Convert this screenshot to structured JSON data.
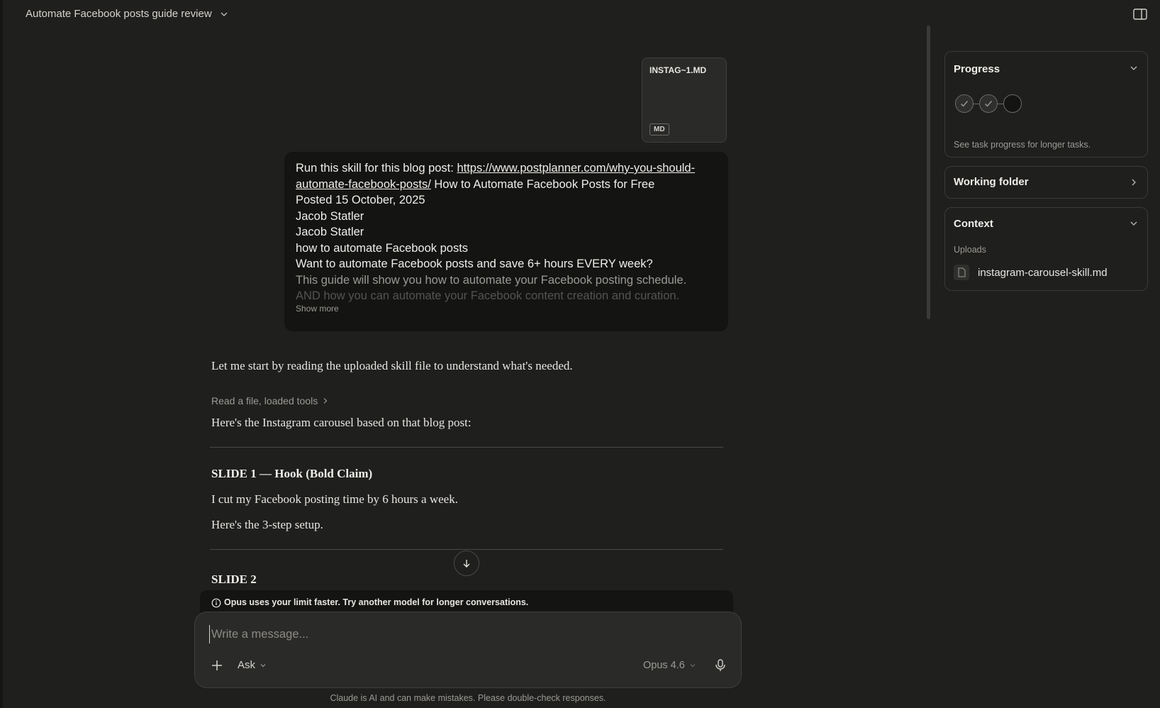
{
  "header": {
    "chat_title": "Automate Facebook posts guide review"
  },
  "attachment": {
    "file_name": "INSTAG~1.MD",
    "file_type": "MD"
  },
  "user_message": {
    "line1_prefix": "Run this skill for this blog post: ",
    "link_text_a": "https://www.postplanner.com/why-you-should-",
    "link_text_b": "automate-facebook-posts/",
    "line2_suffix": " How to Automate Facebook Posts for Free",
    "line3": "Posted 15 October, 2025",
    "line4": "Jacob Statler",
    "line5": "Jacob Statler",
    "line6": "how to automate Facebook posts",
    "line7": "Want to automate Facebook posts and save 6+ hours EVERY week?",
    "line8": "This guide will show you how to automate your Facebook posting schedule.",
    "line9": "AND how you can automate your Facebook content creation and curation.",
    "show_more": "Show more"
  },
  "assistant": {
    "intro": "Let me start by reading the uploaded skill file to understand what's needed.",
    "tool_summary": "Read a file, loaded tools",
    "lead": "Here's the Instagram carousel based on that blog post:",
    "slide1_heading": "SLIDE 1 — Hook (Bold Claim)",
    "slide1_line1": "I cut my Facebook posting time by 6 hours a week.",
    "slide1_line2": "Here's the 3-step setup.",
    "slide2_heading": "SLIDE 2"
  },
  "composer": {
    "warning": "Opus uses your limit faster. Try another model for longer conversations.",
    "placeholder": "Write a message...",
    "mode_label": "Ask",
    "model_label": "Opus 4.6",
    "disclaimer": "Claude is AI and can make mistakes. Please double-check responses."
  },
  "right_panel": {
    "progress_title": "Progress",
    "progress_hint": "See task progress for longer tasks.",
    "progress_steps": [
      {
        "state": "done"
      },
      {
        "state": "done"
      },
      {
        "state": "pending"
      }
    ],
    "working_folder_title": "Working folder",
    "context_title": "Context",
    "uploads_label": "Uploads",
    "upload_file": "instagram-carousel-skill.md"
  },
  "colors": {
    "background": "#1f1f1e",
    "bubble": "#141413",
    "border": "#3a3a38",
    "text": "#e8e6e1",
    "muted": "#9c9a94"
  },
  "icons": [
    "chevron-down-icon",
    "panel-toggle-icon",
    "chevron-right-icon",
    "arrow-down-icon",
    "info-icon",
    "plus-icon",
    "microphone-icon",
    "check-icon",
    "document-icon"
  ]
}
